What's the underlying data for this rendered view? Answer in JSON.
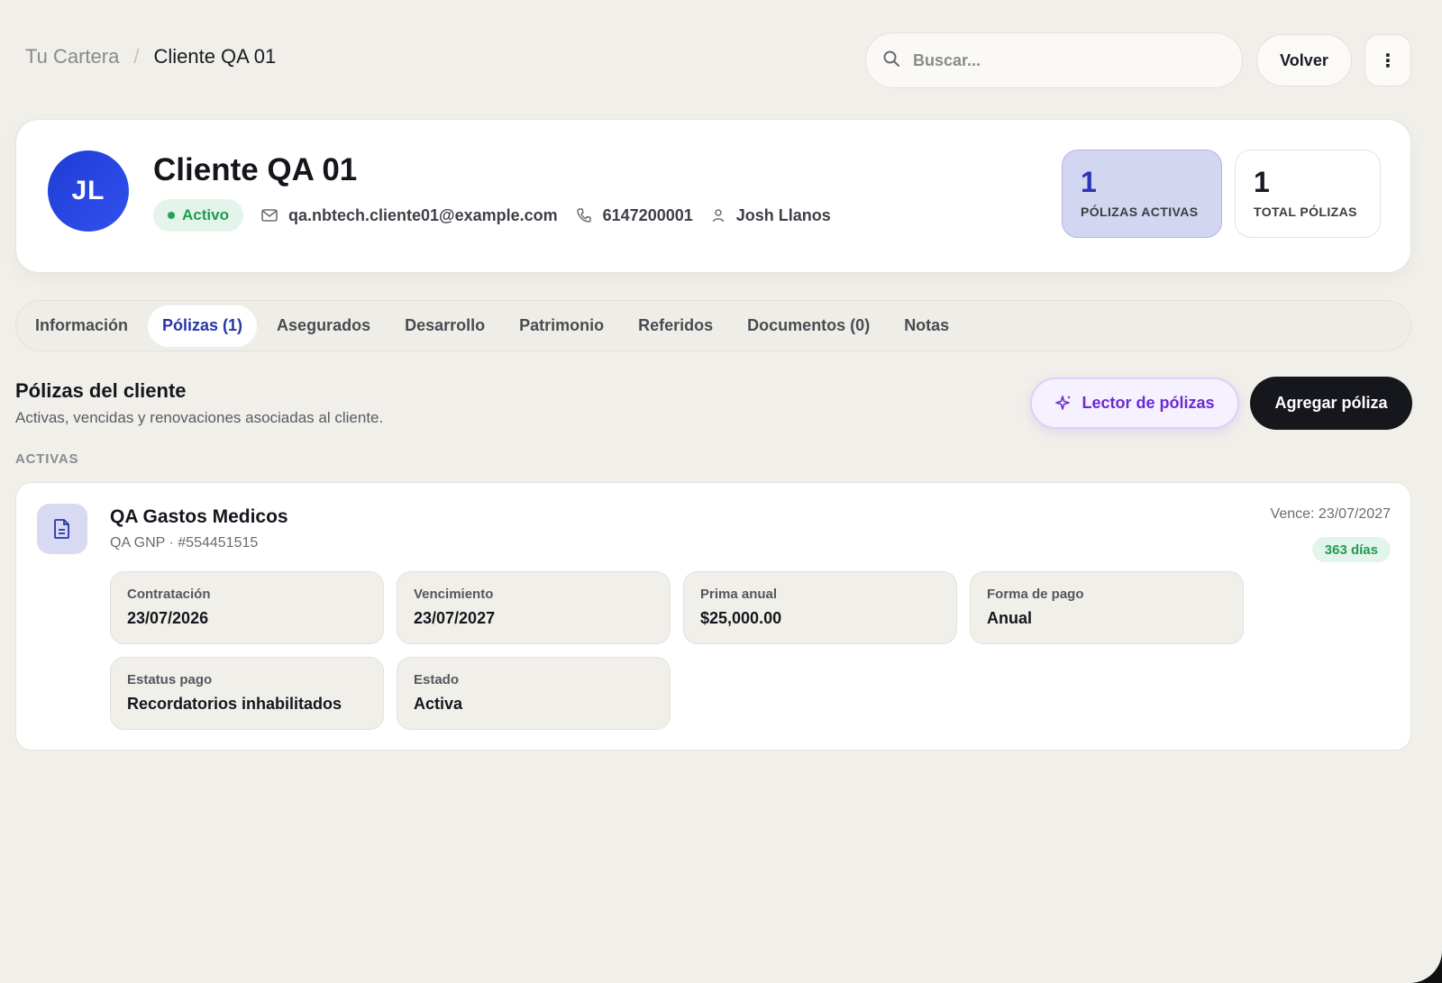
{
  "breadcrumb": {
    "root": "Tu Cartera",
    "separator": "/",
    "current": "Cliente QA 01"
  },
  "search": {
    "placeholder": "Buscar..."
  },
  "header_actions": {
    "back_label": "Volver",
    "more_label": "⋮"
  },
  "client": {
    "initials": "JL",
    "name": "Cliente QA 01",
    "status": "Activo",
    "email": "qa.nbtech.cliente01@example.com",
    "phone": "6147200001",
    "agent": "Josh Llanos",
    "stats": {
      "active_policies": {
        "value": "1",
        "label": "PÓLIZAS ACTIVAS"
      },
      "total_policies": {
        "value": "1",
        "label": "TOTAL PÓLIZAS"
      }
    }
  },
  "tabs": [
    {
      "label": "Información",
      "active": false
    },
    {
      "label": "Pólizas (1)",
      "active": true
    },
    {
      "label": "Asegurados",
      "active": false
    },
    {
      "label": "Desarrollo",
      "active": false
    },
    {
      "label": "Patrimonio",
      "active": false
    },
    {
      "label": "Referidos",
      "active": false
    },
    {
      "label": "Documentos (0)",
      "active": false
    },
    {
      "label": "Notas",
      "active": false
    }
  ],
  "section": {
    "title": "Pólizas del cliente",
    "subtitle": "Activas, vencidas y renovaciones asociadas al cliente.",
    "reader_button": "Lector de pólizas",
    "add_button": "Agregar póliza",
    "group_label": "ACTIVAS"
  },
  "policy": {
    "name": "QA Gastos Medicos",
    "subtitle": "QA GNP · #554451515",
    "due": "Vence: 23/07/2027",
    "days_left": "363 días",
    "fields": [
      {
        "label": "Contratación",
        "value": "23/07/2026"
      },
      {
        "label": "Vencimiento",
        "value": "23/07/2027"
      },
      {
        "label": "Prima anual",
        "value": "$25,000.00"
      },
      {
        "label": "Forma de pago",
        "value": "Anual"
      },
      {
        "label": "Estatus pago",
        "value": "Recordatorios inhabilitados"
      },
      {
        "label": "Estado",
        "value": "Activa"
      }
    ]
  },
  "colors": {
    "background": "#f1efea",
    "accent_blue": "#2736a6",
    "avatar_blue": "#2a46e0",
    "status_green": "#1e9b4f",
    "reader_purple": "#6a2bd6",
    "primary_dark": "#16171c"
  }
}
